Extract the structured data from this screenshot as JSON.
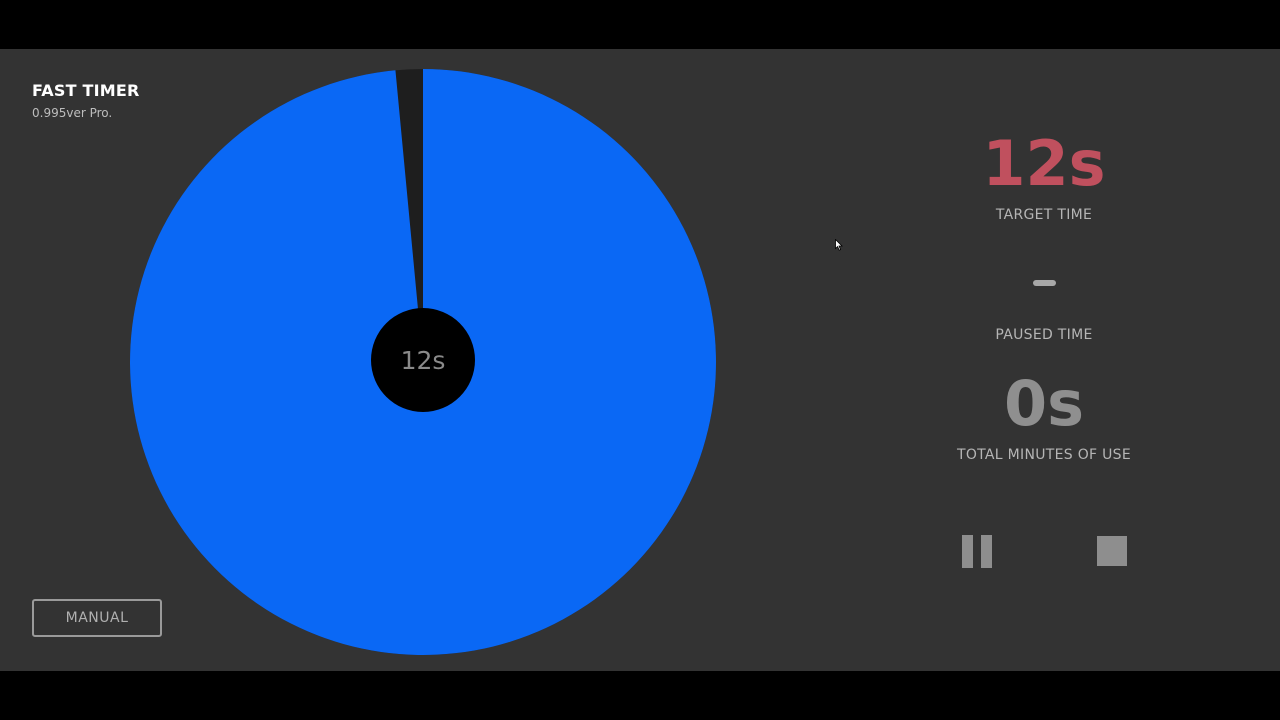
{
  "app": {
    "title": "FAST TIMER",
    "version": "0.995ver Pro."
  },
  "timer": {
    "center_label": "12s",
    "remaining_fraction": 0.985,
    "colors": {
      "remaining": "#0a68f5",
      "elapsed": "#1e1e1e",
      "center": "#000000"
    }
  },
  "stats": {
    "target_time": {
      "value": "12s",
      "label": "TARGET TIME",
      "color": "#c0505e"
    },
    "paused_time": {
      "label": "PAUSED TIME"
    },
    "total_use": {
      "value": "0s",
      "label": "TOTAL MINUTES OF USE"
    }
  },
  "controls": {
    "manual_label": "MANUAL",
    "pause_icon": "pause-icon",
    "stop_icon": "stop-icon"
  }
}
